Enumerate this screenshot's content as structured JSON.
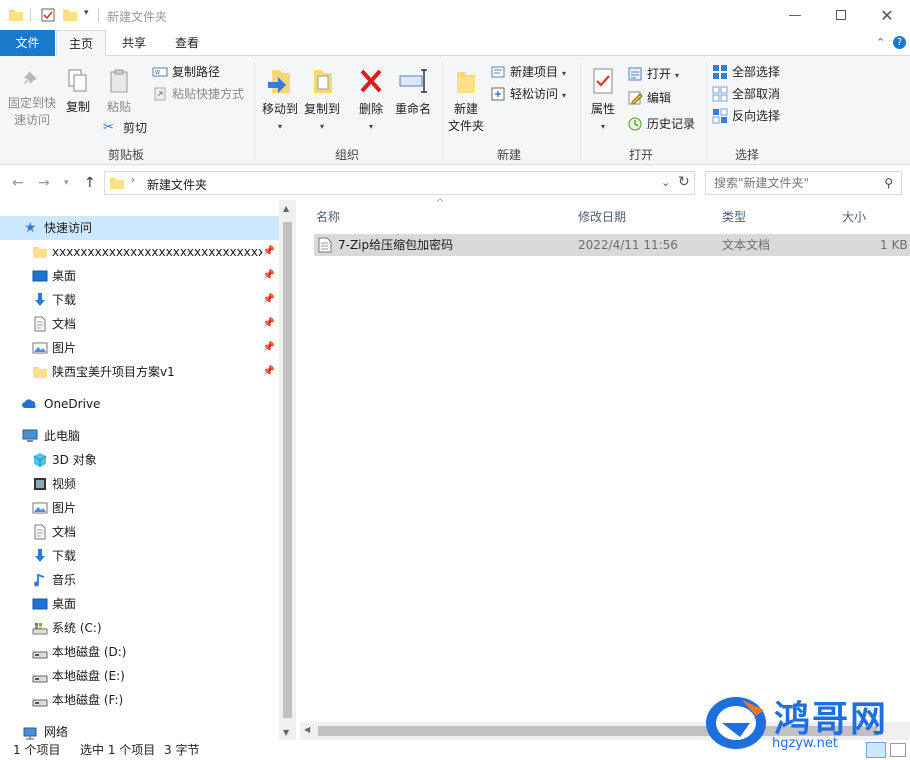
{
  "window": {
    "title": "新建文件夹",
    "controls": [
      "minimize",
      "maximize",
      "close"
    ]
  },
  "tabs": {
    "file": "文件",
    "home": "主页",
    "share": "共享",
    "view": "查看"
  },
  "ribbon": {
    "clipboard": {
      "group": "剪贴板",
      "pin_quick": "固定到快速访问",
      "pin_quick_l1": "固定到快",
      "pin_quick_l2": "速访问",
      "copy": "复制",
      "paste": "粘贴",
      "copy_path": "复制路径",
      "paste_shortcut": "粘贴快捷方式",
      "cut": "剪切"
    },
    "organize": {
      "group": "组织",
      "move_to": "移动到",
      "copy_to": "复制到",
      "delete": "删除",
      "rename": "重命名"
    },
    "new": {
      "group": "新建",
      "new_item": "新建项目",
      "easy_access": "轻松访问",
      "new_folder_l1": "新建",
      "new_folder_l2": "文件夹"
    },
    "open": {
      "group": "打开",
      "properties": "属性",
      "open": "打开",
      "edit": "编辑",
      "history": "历史记录"
    },
    "select": {
      "group": "选择",
      "select_all": "全部选择",
      "select_none": "全部取消",
      "invert": "反向选择"
    }
  },
  "address": {
    "crumb": "新建文件夹",
    "search_placeholder": "搜索\"新建文件夹\""
  },
  "nav": {
    "quick_access": "快速访问",
    "quick_items": [
      "xxxxxxxxxxxxxxxxxxxxxxxxxxxxxxxxxxxxxxxxxxxx",
      "桌面",
      "下载",
      "文档",
      "图片",
      "陕西宝美升项目方案v1"
    ],
    "onedrive": "OneDrive",
    "this_pc": "此电脑",
    "pc_items": [
      "3D 对象",
      "视频",
      "图片",
      "文档",
      "下载",
      "音乐",
      "桌面",
      "系统 (C:)",
      "本地磁盘 (D:)",
      "本地磁盘 (E:)",
      "本地磁盘 (F:)"
    ],
    "network": "网络"
  },
  "columns": {
    "name": "名称",
    "modified": "修改日期",
    "type": "类型",
    "size": "大小"
  },
  "files": [
    {
      "name": "7-Zip给压缩包加密码",
      "modified": "2022/4/11 11:56",
      "type": "文本文档",
      "size": "1 KB"
    }
  ],
  "status": {
    "count": "1 个项目",
    "selected": "选中 1 个项目",
    "bytes": "3 字节"
  },
  "watermark": {
    "text": "鸿哥网",
    "url": "hgzyw.net"
  },
  "colors": {
    "accent": "#1979ca",
    "selection": "#cce8ff",
    "folder": "#f8d775",
    "watermark": "#1d6fe0"
  }
}
